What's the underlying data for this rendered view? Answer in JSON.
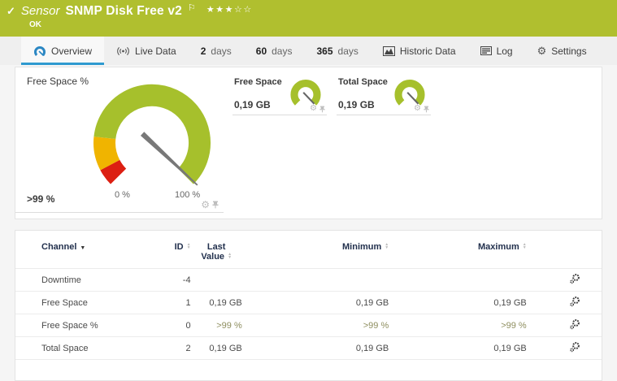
{
  "header": {
    "kind_label": "Sensor",
    "title": "SNMP Disk Free v2",
    "status": "OK",
    "rating_filled": "★★★",
    "rating_empty": "☆☆",
    "accent_color": "#b0bf2f"
  },
  "icons": {
    "check": "✓",
    "flag": "⚐",
    "gear": "⚙",
    "sort_asc": "▲",
    "sort_desc": "▼",
    "sorted": "▼"
  },
  "tabs": {
    "overview": {
      "label": "Overview",
      "icon": "gauge-icon",
      "active": true
    },
    "live_data": {
      "label": "Live Data",
      "icon": "broadcast-icon"
    },
    "days2": {
      "num": "2",
      "suffix": "days"
    },
    "days60": {
      "num": "60",
      "suffix": "days"
    },
    "days365": {
      "num": "365",
      "suffix": "days"
    },
    "historic": {
      "label": "Historic Data",
      "icon": "area-chart-icon"
    },
    "log": {
      "label": "Log",
      "icon": "log-icon"
    },
    "settings": {
      "label": "Settings",
      "icon": "gear-icon"
    }
  },
  "gauges": {
    "primary": {
      "title": "Free Space %",
      "value": ">99 %",
      "scale_min": "0 %",
      "scale_max": "100 %",
      "colors": {
        "green": "#a6c02c",
        "yellow": "#f0b400",
        "red": "#dc1f12",
        "needle": "#787878"
      }
    },
    "small": [
      {
        "title": "Free Space",
        "value": "0,19 GB"
      },
      {
        "title": "Total Space",
        "value": "0,19 GB"
      }
    ]
  },
  "table": {
    "header": {
      "channel": "Channel",
      "id": "ID",
      "last_line1": "Last",
      "last_line2": "Value",
      "min": "Minimum",
      "max": "Maximum"
    },
    "rows": [
      {
        "channel": "Downtime",
        "id": "-4",
        "last": "",
        "min": "",
        "max": ""
      },
      {
        "channel": "Free Space",
        "id": "1",
        "last": "0,19 GB",
        "min": "0,19 GB",
        "max": "0,19 GB"
      },
      {
        "channel": "Free Space %",
        "id": "0",
        "last": ">99 %",
        "min": ">99 %",
        "max": ">99 %",
        "highlight": true
      },
      {
        "channel": "Total Space",
        "id": "2",
        "last": "0,19 GB",
        "min": "0,19 GB",
        "max": "0,19 GB"
      }
    ]
  }
}
